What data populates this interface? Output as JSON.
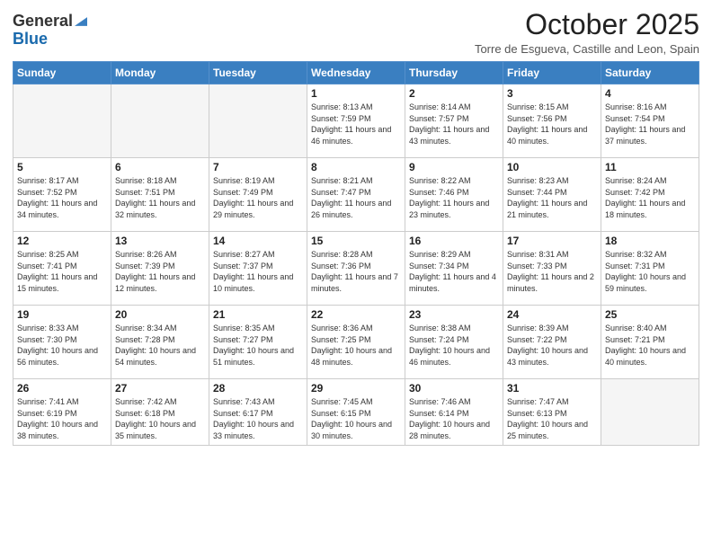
{
  "header": {
    "logo_general": "General",
    "logo_blue": "Blue",
    "month_title": "October 2025",
    "subtitle": "Torre de Esgueva, Castille and Leon, Spain"
  },
  "weekdays": [
    "Sunday",
    "Monday",
    "Tuesday",
    "Wednesday",
    "Thursday",
    "Friday",
    "Saturday"
  ],
  "weeks": [
    [
      {
        "day": "",
        "info": ""
      },
      {
        "day": "",
        "info": ""
      },
      {
        "day": "",
        "info": ""
      },
      {
        "day": "1",
        "info": "Sunrise: 8:13 AM\nSunset: 7:59 PM\nDaylight: 11 hours and 46 minutes."
      },
      {
        "day": "2",
        "info": "Sunrise: 8:14 AM\nSunset: 7:57 PM\nDaylight: 11 hours and 43 minutes."
      },
      {
        "day": "3",
        "info": "Sunrise: 8:15 AM\nSunset: 7:56 PM\nDaylight: 11 hours and 40 minutes."
      },
      {
        "day": "4",
        "info": "Sunrise: 8:16 AM\nSunset: 7:54 PM\nDaylight: 11 hours and 37 minutes."
      }
    ],
    [
      {
        "day": "5",
        "info": "Sunrise: 8:17 AM\nSunset: 7:52 PM\nDaylight: 11 hours and 34 minutes."
      },
      {
        "day": "6",
        "info": "Sunrise: 8:18 AM\nSunset: 7:51 PM\nDaylight: 11 hours and 32 minutes."
      },
      {
        "day": "7",
        "info": "Sunrise: 8:19 AM\nSunset: 7:49 PM\nDaylight: 11 hours and 29 minutes."
      },
      {
        "day": "8",
        "info": "Sunrise: 8:21 AM\nSunset: 7:47 PM\nDaylight: 11 hours and 26 minutes."
      },
      {
        "day": "9",
        "info": "Sunrise: 8:22 AM\nSunset: 7:46 PM\nDaylight: 11 hours and 23 minutes."
      },
      {
        "day": "10",
        "info": "Sunrise: 8:23 AM\nSunset: 7:44 PM\nDaylight: 11 hours and 21 minutes."
      },
      {
        "day": "11",
        "info": "Sunrise: 8:24 AM\nSunset: 7:42 PM\nDaylight: 11 hours and 18 minutes."
      }
    ],
    [
      {
        "day": "12",
        "info": "Sunrise: 8:25 AM\nSunset: 7:41 PM\nDaylight: 11 hours and 15 minutes."
      },
      {
        "day": "13",
        "info": "Sunrise: 8:26 AM\nSunset: 7:39 PM\nDaylight: 11 hours and 12 minutes."
      },
      {
        "day": "14",
        "info": "Sunrise: 8:27 AM\nSunset: 7:37 PM\nDaylight: 11 hours and 10 minutes."
      },
      {
        "day": "15",
        "info": "Sunrise: 8:28 AM\nSunset: 7:36 PM\nDaylight: 11 hours and 7 minutes."
      },
      {
        "day": "16",
        "info": "Sunrise: 8:29 AM\nSunset: 7:34 PM\nDaylight: 11 hours and 4 minutes."
      },
      {
        "day": "17",
        "info": "Sunrise: 8:31 AM\nSunset: 7:33 PM\nDaylight: 11 hours and 2 minutes."
      },
      {
        "day": "18",
        "info": "Sunrise: 8:32 AM\nSunset: 7:31 PM\nDaylight: 10 hours and 59 minutes."
      }
    ],
    [
      {
        "day": "19",
        "info": "Sunrise: 8:33 AM\nSunset: 7:30 PM\nDaylight: 10 hours and 56 minutes."
      },
      {
        "day": "20",
        "info": "Sunrise: 8:34 AM\nSunset: 7:28 PM\nDaylight: 10 hours and 54 minutes."
      },
      {
        "day": "21",
        "info": "Sunrise: 8:35 AM\nSunset: 7:27 PM\nDaylight: 10 hours and 51 minutes."
      },
      {
        "day": "22",
        "info": "Sunrise: 8:36 AM\nSunset: 7:25 PM\nDaylight: 10 hours and 48 minutes."
      },
      {
        "day": "23",
        "info": "Sunrise: 8:38 AM\nSunset: 7:24 PM\nDaylight: 10 hours and 46 minutes."
      },
      {
        "day": "24",
        "info": "Sunrise: 8:39 AM\nSunset: 7:22 PM\nDaylight: 10 hours and 43 minutes."
      },
      {
        "day": "25",
        "info": "Sunrise: 8:40 AM\nSunset: 7:21 PM\nDaylight: 10 hours and 40 minutes."
      }
    ],
    [
      {
        "day": "26",
        "info": "Sunrise: 7:41 AM\nSunset: 6:19 PM\nDaylight: 10 hours and 38 minutes."
      },
      {
        "day": "27",
        "info": "Sunrise: 7:42 AM\nSunset: 6:18 PM\nDaylight: 10 hours and 35 minutes."
      },
      {
        "day": "28",
        "info": "Sunrise: 7:43 AM\nSunset: 6:17 PM\nDaylight: 10 hours and 33 minutes."
      },
      {
        "day": "29",
        "info": "Sunrise: 7:45 AM\nSunset: 6:15 PM\nDaylight: 10 hours and 30 minutes."
      },
      {
        "day": "30",
        "info": "Sunrise: 7:46 AM\nSunset: 6:14 PM\nDaylight: 10 hours and 28 minutes."
      },
      {
        "day": "31",
        "info": "Sunrise: 7:47 AM\nSunset: 6:13 PM\nDaylight: 10 hours and 25 minutes."
      },
      {
        "day": "",
        "info": ""
      }
    ]
  ]
}
